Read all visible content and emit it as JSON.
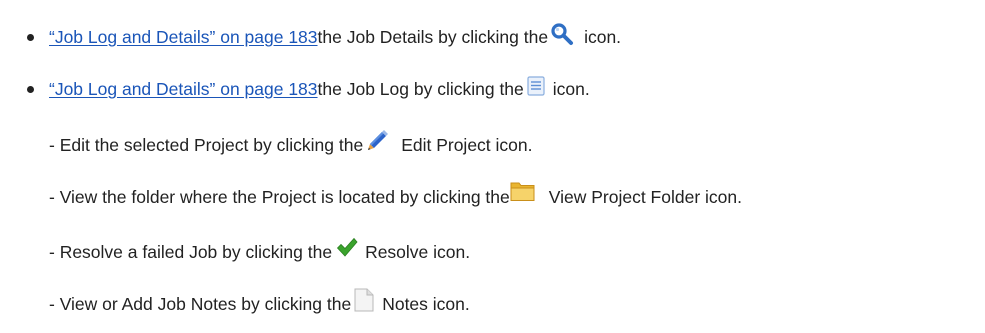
{
  "bullets": [
    {
      "link": "“Job Log and Details” on page 183",
      "text_before": " the Job Details by clicking the ",
      "icon": "magnifier-icon",
      "text_after": "icon."
    },
    {
      "link": "“Job Log and Details” on page 183",
      "text_before": " the Job Log by clicking the ",
      "icon": "document-lines-icon",
      "text_after": "icon."
    }
  ],
  "subitems": [
    {
      "text_before": "- Edit the selected Project by clicking the ",
      "icon": "pencil-icon",
      "text_after": "Edit Project icon."
    },
    {
      "text_before": "- View the folder where the Project is located by clicking the ",
      "icon": "folder-icon",
      "text_after": "View Project Folder icon."
    },
    {
      "text_before": "- Resolve a failed Job by clicking the ",
      "icon": "checkmark-icon",
      "text_after": "Resolve icon."
    },
    {
      "text_before": "- View or Add Job Notes by clicking the ",
      "icon": "notes-icon",
      "text_after": "Notes icon."
    }
  ],
  "colors": {
    "link": "#1a55b8",
    "text": "#222222",
    "magnifier": "#2f6fc4",
    "pencil_body": "#2c63c9",
    "pencil_tip": "#e8a040",
    "folder": "#f3c64a",
    "check": "#3aa32c"
  }
}
